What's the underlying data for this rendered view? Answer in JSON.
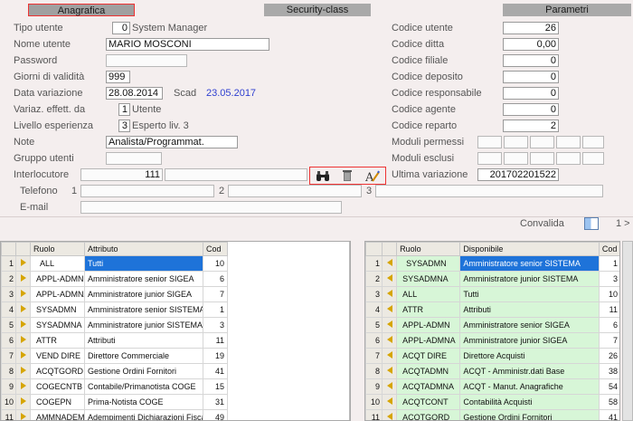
{
  "tabs": {
    "anagrafica": "Anagrafica",
    "security": "Security-class",
    "parametri": "Parametri"
  },
  "form": {
    "tipo_utente": {
      "label": "Tipo utente",
      "code": "0",
      "desc": "System Manager"
    },
    "nome_utente": {
      "label": "Nome utente",
      "value": "MARIO MOSCONI"
    },
    "password": {
      "label": "Password",
      "value": ""
    },
    "giorni_validita": {
      "label": "Giorni di validità",
      "value": "999"
    },
    "data_variazione": {
      "label": "Data variazione",
      "value": "28.08.2014",
      "scad_label": "Scad",
      "scad_value": "23.05.2017"
    },
    "variaz_effett": {
      "label": "Variaz. effett. da",
      "code": "1",
      "desc": "Utente"
    },
    "livello_esperienza": {
      "label": "Livello esperienza",
      "code": "3",
      "desc": "Esperto liv. 3"
    },
    "note": {
      "label": "Note",
      "value": "Analista/Programmat."
    },
    "gruppo_utenti": {
      "label": "Gruppo utenti",
      "value": ""
    },
    "interlocutore": {
      "label": "Interlocutore",
      "value": "111"
    },
    "telefono": {
      "label": "Telefono",
      "n1": "1",
      "n2": "2",
      "n3": "3"
    },
    "email": {
      "label": "E-mail"
    },
    "codice_utente": {
      "label": "Codice utente",
      "value": "26"
    },
    "codice_ditta": {
      "label": "Codice ditta",
      "value": "0,00"
    },
    "codice_filiale": {
      "label": "Codice filiale",
      "value": "0"
    },
    "codice_deposito": {
      "label": "Codice deposito",
      "value": "0"
    },
    "codice_responsabile": {
      "label": "Codice responsabile",
      "value": "0"
    },
    "codice_agente": {
      "label": "Codice agente",
      "value": "0"
    },
    "codice_reparto": {
      "label": "Codice reparto",
      "value": "2"
    },
    "moduli_permessi": {
      "label": "Moduli permessi"
    },
    "moduli_esclusi": {
      "label": "Moduli esclusi"
    },
    "ultima_variazione": {
      "label": "Ultima variazione",
      "value": "201702201522"
    }
  },
  "validate": {
    "label": "Convalida",
    "page": "1 >"
  },
  "left_grid": {
    "headers": [
      "Ruolo",
      "Attributo",
      "Cod"
    ],
    "rows": [
      [
        "1",
        "ALL",
        "Tutti",
        "10"
      ],
      [
        "2",
        "APPL-ADMN",
        "Amministratore senior SIGEA",
        "6"
      ],
      [
        "3",
        "APPL-ADMNA",
        "Amministratore junior SIGEA",
        "7"
      ],
      [
        "4",
        "SYSADMN",
        "Amministratore senior SISTEMA",
        "1"
      ],
      [
        "5",
        "SYSADMNA",
        "Amministratore junior SISTEMA",
        "3"
      ],
      [
        "6",
        "ATTR",
        "Attributi",
        "11"
      ],
      [
        "7",
        "VEND DIRE",
        "Direttore Commerciale",
        "19"
      ],
      [
        "8",
        "ACQTGORD",
        "Gestione Ordini Fornitori",
        "41"
      ],
      [
        "9",
        "COGECNTB",
        "Contabile/Primanotista   COGE",
        "15"
      ],
      [
        "10",
        "COGEPN",
        "Prima-Notista          COGE",
        "31"
      ],
      [
        "11",
        "AMMNADEMD",
        "Adempimenti Dichiarazioni Fiscali",
        "49"
      ]
    ]
  },
  "right_grid": {
    "headers": [
      "Ruolo",
      "Disponibile",
      "Cod"
    ],
    "rows": [
      [
        "1",
        "SYSADMN",
        "Amministratore senior SISTEMA",
        "1"
      ],
      [
        "2",
        "SYSADMNA",
        "Amministratore junior SISTEMA",
        "3"
      ],
      [
        "3",
        "ALL",
        "Tutti",
        "10"
      ],
      [
        "4",
        "ATTR",
        "Attributi",
        "11"
      ],
      [
        "5",
        "APPL-ADMN",
        "Amministratore senior SIGEA",
        "6"
      ],
      [
        "6",
        "APPL-ADMNA",
        "Amministratore junior SIGEA",
        "7"
      ],
      [
        "7",
        "ACQT DIRE",
        "Direttore Acquisti",
        "26"
      ],
      [
        "8",
        "ACQTADMN",
        "ACQT - Amministr.dati Base",
        "38"
      ],
      [
        "9",
        "ACQTADMNA",
        "ACQT - Manut. Anagrafiche",
        "54"
      ],
      [
        "10",
        "ACQTCONT",
        "Contabilità Acquisti",
        "58"
      ],
      [
        "11",
        "ACQTGORD",
        "Gestione Ordini Fornitori",
        "41"
      ]
    ]
  },
  "colors": {
    "selection": "#1e73d9",
    "available_row": "#d7f6d7",
    "arrow": "#d6a500",
    "highlight_border": "#ee3333"
  },
  "icons": {
    "search": "binoculars-icon",
    "delete": "trash-icon",
    "edit": "edit-text-icon"
  }
}
